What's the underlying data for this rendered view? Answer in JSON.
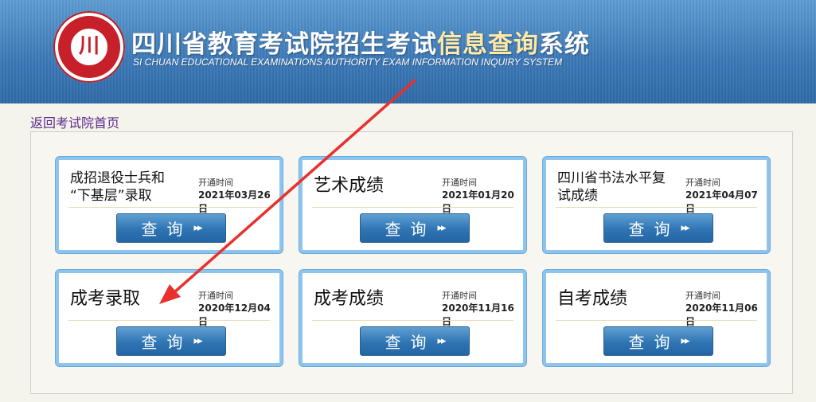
{
  "header": {
    "logo_glyph": "川",
    "title_part1": "四川省教育考试院招生考试",
    "title_highlight": "信息查询",
    "title_part2": "系统",
    "subtitle": "SI CHUAN EDUCATIONAL EXAMINATIONS AUTHORITY EXAM INFORMATION INQUIRY SYSTEM"
  },
  "back_link": "返回考试院首页",
  "cards": [
    {
      "title_line1": "成招退役士兵和",
      "title_line2": "“下基层”录取",
      "open_label": "开通时间",
      "open_date": "2021年03月26日",
      "button": "查询",
      "button_icon": "▸▸"
    },
    {
      "title_line1": "艺术成绩",
      "open_label": "开通时间",
      "open_date": "2021年01月20日",
      "button": "查询",
      "button_icon": "▸▸"
    },
    {
      "title_line1": "四川省书法水平复",
      "title_line2": "试成绩",
      "open_label": "开通时间",
      "open_date": "2021年04月07日",
      "button": "查询",
      "button_icon": "▸▸"
    },
    {
      "title_line1": "成考录取",
      "open_label": "开通时间",
      "open_date": "2020年12月04日",
      "button": "查询",
      "button_icon": "▸▸"
    },
    {
      "title_line1": "成考成绩",
      "open_label": "开通时间",
      "open_date": "2020年11月16日",
      "button": "查询",
      "button_icon": "▸▸"
    },
    {
      "title_line1": "自考成绩",
      "open_label": "开通时间",
      "open_date": "2020年11月06日",
      "button": "查询",
      "button_icon": "▸▸"
    }
  ],
  "colors": {
    "header_blue": "#3a77b6",
    "card_border": "#8ec5ef",
    "button_blue": "#2f74b3",
    "annotation_arrow": "#e8312e",
    "back_link": "#5b2b8a"
  }
}
